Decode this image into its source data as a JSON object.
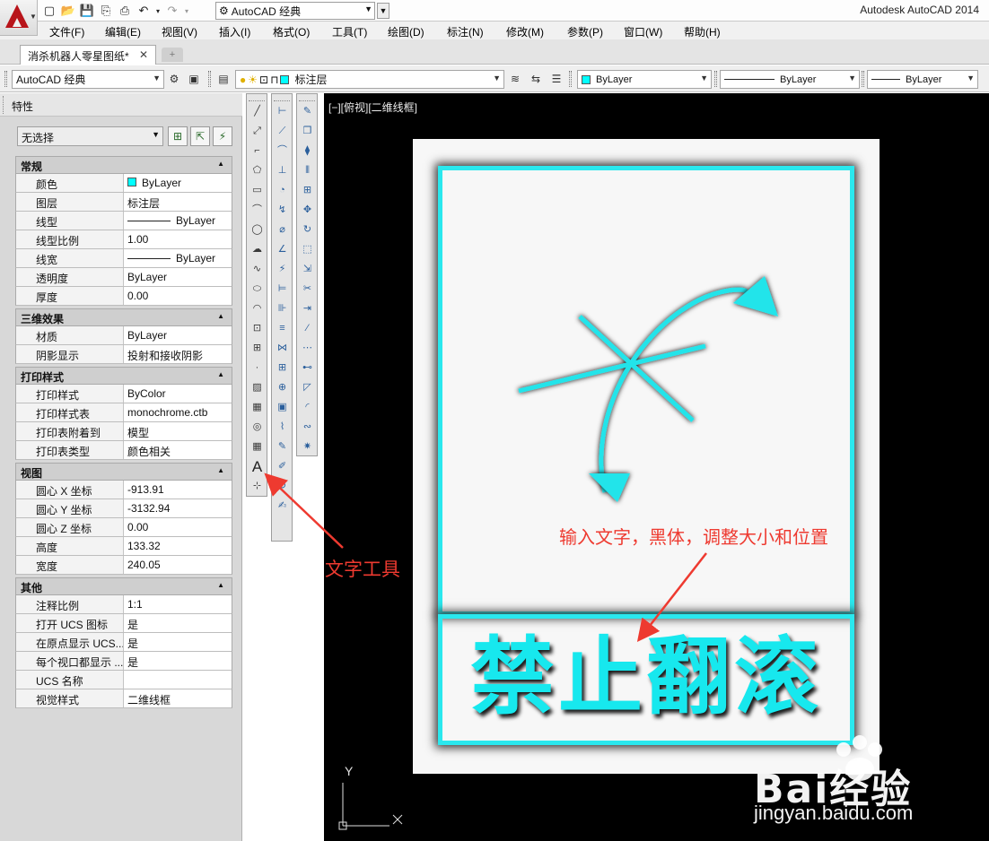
{
  "app": {
    "title": "Autodesk AutoCAD 2014",
    "workspace": "AutoCAD 经典",
    "document_tab": "消杀机器人零星图纸*"
  },
  "menu": [
    "文件(F)",
    "编辑(E)",
    "视图(V)",
    "插入(I)",
    "格式(O)",
    "工具(T)",
    "绘图(D)",
    "标注(N)",
    "修改(M)",
    "参数(P)",
    "窗口(W)",
    "帮助(H)"
  ],
  "toolbar": {
    "workspace_combo": "AutoCAD 经典",
    "layer_combo": "标注层",
    "color_combo": "ByLayer",
    "linetype_combo": "ByLayer",
    "lineweight_combo": "ByLayer"
  },
  "properties": {
    "title": "特性",
    "selection": "无选择",
    "sections": [
      {
        "name": "常规",
        "rows": [
          {
            "k": "颜色",
            "v": "ByLayer",
            "type": "color"
          },
          {
            "k": "图层",
            "v": "标注层"
          },
          {
            "k": "线型",
            "v": "ByLayer",
            "type": "line"
          },
          {
            "k": "线型比例",
            "v": "1.00"
          },
          {
            "k": "线宽",
            "v": "ByLayer",
            "type": "line"
          },
          {
            "k": "透明度",
            "v": "ByLayer"
          },
          {
            "k": "厚度",
            "v": "0.00"
          }
        ]
      },
      {
        "name": "三维效果",
        "rows": [
          {
            "k": "材质",
            "v": "ByLayer"
          },
          {
            "k": "阴影显示",
            "v": "投射和接收阴影"
          }
        ]
      },
      {
        "name": "打印样式",
        "rows": [
          {
            "k": "打印样式",
            "v": "ByColor"
          },
          {
            "k": "打印样式表",
            "v": "monochrome.ctb"
          },
          {
            "k": "打印表附着到",
            "v": "模型"
          },
          {
            "k": "打印表类型",
            "v": "颜色相关"
          }
        ]
      },
      {
        "name": "视图",
        "rows": [
          {
            "k": "圆心 X 坐标",
            "v": "-913.91"
          },
          {
            "k": "圆心 Y 坐标",
            "v": "-3132.94"
          },
          {
            "k": "圆心 Z 坐标",
            "v": "0.00"
          },
          {
            "k": "高度",
            "v": "133.32"
          },
          {
            "k": "宽度",
            "v": "240.05"
          }
        ]
      },
      {
        "name": "其他",
        "rows": [
          {
            "k": "注释比例",
            "v": "1:1"
          },
          {
            "k": "打开 UCS 图标",
            "v": "是"
          },
          {
            "k": "在原点显示 UCS...",
            "v": "是"
          },
          {
            "k": "每个视口都显示 ...",
            "v": "是"
          },
          {
            "k": "UCS 名称",
            "v": ""
          },
          {
            "k": "视觉样式",
            "v": "二维线框"
          }
        ]
      }
    ]
  },
  "viewport": {
    "label": "[−][俯视][二维线框]",
    "ucs_y": "Y"
  },
  "sign": {
    "text": "禁止翻滚",
    "color": "#17e8ee"
  },
  "annotations": {
    "instruction": "输入文字，黑体，调整大小和位置",
    "text_tool": "文字工具",
    "color": "#ee3a30"
  },
  "watermark": {
    "brand": "Bai经验",
    "url": "jingyan.baidu.com"
  },
  "icons": {
    "draw_toolbar": [
      "line-icon",
      "construction-line-icon",
      "polyline-icon",
      "polygon-icon",
      "rectangle-icon",
      "arc-icon",
      "circle-icon",
      "revision-cloud-icon",
      "spline-icon",
      "ellipse-icon",
      "ellipse-arc-icon",
      "insert-block-icon",
      "make-block-icon",
      "point-icon",
      "hatch-icon",
      "gradient-icon",
      "region-icon",
      "table-icon",
      "multiline-text-icon",
      "add-selected-icon"
    ],
    "dimension_toolbar": [
      "linear-dim-icon",
      "aligned-dim-icon",
      "arc-length-icon",
      "ordinate-icon",
      "radius-icon",
      "jogged-icon",
      "diameter-icon",
      "angular-icon",
      "quick-dim-icon",
      "baseline-icon",
      "continue-icon",
      "dim-space-icon",
      "dim-break-icon",
      "tolerance-icon",
      "center-mark-icon",
      "inspection-icon",
      "jogged-linear-icon",
      "dim-edit-icon",
      "dim-text-edit-icon",
      "dim-update-icon",
      "dim-style-icon"
    ],
    "modify_toolbar": [
      "erase-icon",
      "copy-icon",
      "mirror-icon",
      "offset-icon",
      "array-icon",
      "move-icon",
      "rotate-icon",
      "scale-icon",
      "stretch-icon",
      "trim-icon",
      "extend-icon",
      "break-at-point-icon",
      "break-icon",
      "join-icon",
      "chamfer-icon",
      "fillet-icon",
      "blend-curves-icon",
      "explode-icon"
    ]
  }
}
